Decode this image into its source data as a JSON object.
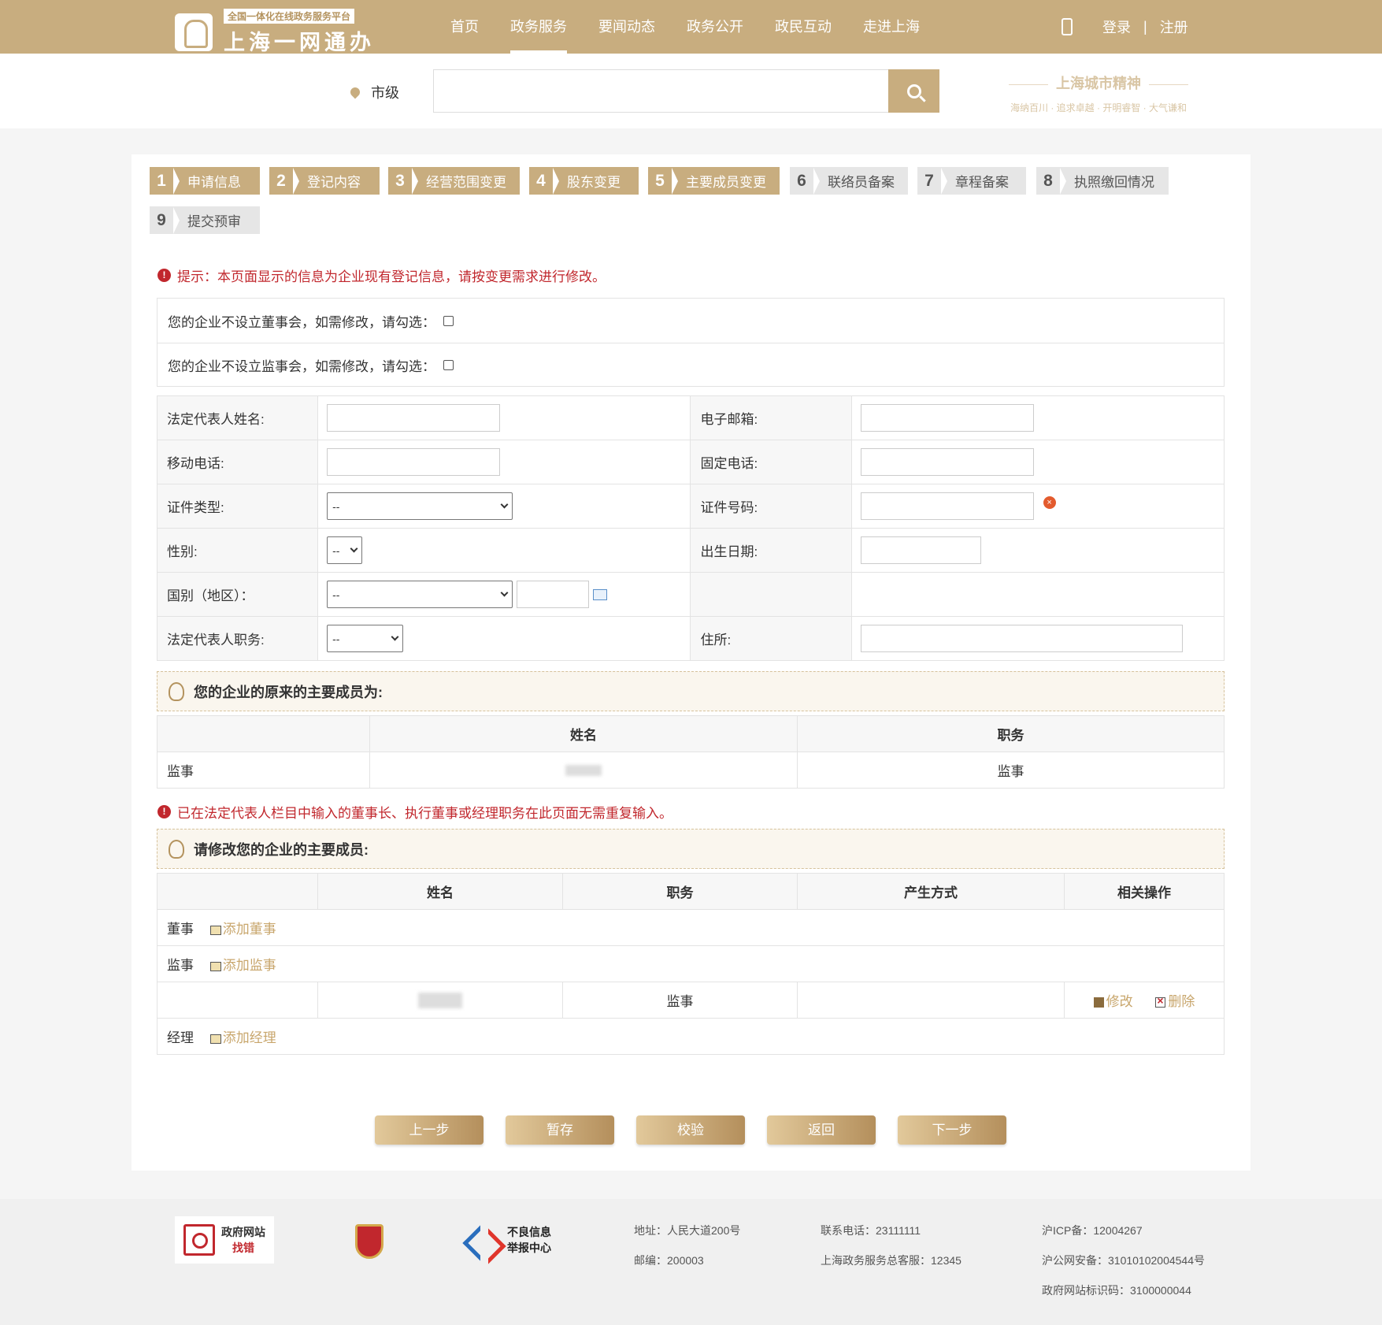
{
  "header": {
    "logo_sub": "全国一体化在线政务服务平台",
    "logo_main": "上海一网通办",
    "nav": [
      "首页",
      "政务服务",
      "要闻动态",
      "政务公开",
      "政民互动",
      "走进上海"
    ],
    "active_nav": 1,
    "login": "登录",
    "divider": "|",
    "register": "注册",
    "brand_color": "#c8ad7f"
  },
  "search": {
    "location": "市级",
    "placeholder": "",
    "spirit_title": "上海城市精神",
    "spirit_sub": "海纳百川 · 追求卓越 · 开明睿智 · 大气谦和"
  },
  "steps": [
    {
      "num": "1",
      "label": "申请信息",
      "done": true
    },
    {
      "num": "2",
      "label": "登记内容",
      "done": true
    },
    {
      "num": "3",
      "label": "经营范围变更",
      "done": true
    },
    {
      "num": "4",
      "label": "股东变更",
      "done": true
    },
    {
      "num": "5",
      "label": "主要成员变更",
      "done": true
    },
    {
      "num": "6",
      "label": "联络员备案",
      "done": false
    },
    {
      "num": "7",
      "label": "章程备案",
      "done": false
    },
    {
      "num": "8",
      "label": "执照缴回情况",
      "done": false
    },
    {
      "num": "9",
      "label": "提交预审",
      "done": false
    }
  ],
  "notice": "提示：本页面显示的信息为企业现有登记信息，请按变更需求进行修改。",
  "checks": {
    "board": "您的企业不设立董事会，如需修改，请勾选：",
    "supervisory": "您的企业不设立监事会，如需修改，请勾选："
  },
  "form": {
    "legal_name_label": "法定代表人姓名:",
    "email_label": "电子邮箱:",
    "mobile_label": "移动电话:",
    "landline_label": "固定电话:",
    "id_type_label": "证件类型:",
    "id_type_value": "--",
    "id_number_label": "证件号码:",
    "gender_label": "性别:",
    "gender_value": "--",
    "birth_label": "出生日期:",
    "nationality_label": "国别（地区）：",
    "nationality_value": "--",
    "position_label": "法定代表人职务:",
    "position_value": "--",
    "address_label": "住所:"
  },
  "original_section": {
    "title": "您的企业的原来的主要成员为:",
    "headers": [
      "",
      "姓名",
      "职务"
    ],
    "rows": [
      {
        "type": "监事",
        "position": "监事"
      }
    ]
  },
  "notice2": "已在法定代表人栏目中输入的董事长、执行董事或经理职务在此页面无需重复输入。",
  "edit_section": {
    "title": "请修改您的企业的主要成员:",
    "headers": [
      "",
      "姓名",
      "职务",
      "产生方式",
      "相关操作"
    ],
    "director": "董事",
    "add_director": "添加董事",
    "supervisor": "监事",
    "add_supervisor": "添加监事",
    "member_position": "监事",
    "edit": "修改",
    "delete": "删除",
    "manager": "经理",
    "add_manager": "添加经理"
  },
  "buttons": [
    "上一步",
    "暂存",
    "校验",
    "返回",
    "下一步"
  ],
  "footer": {
    "badge1_line1": "政府网站",
    "badge1_line2": "找错",
    "badge3_line1": "不良信息",
    "badge3_line2": "举报中心",
    "address": "地址：人民大道200号",
    "postcode": "邮编：200003",
    "phone": "联系电话：23111111",
    "hotline": "上海政务服务总客服：12345",
    "icp": "沪ICP备：12004267",
    "police": "沪公网安备：31010102004544号",
    "site_id": "政府网站标识码：3100000044"
  }
}
